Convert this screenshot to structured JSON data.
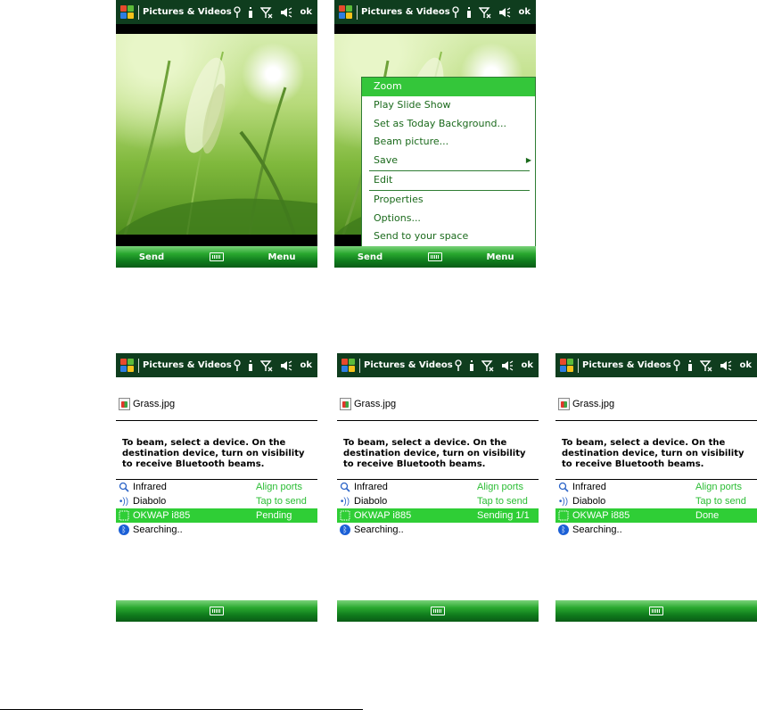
{
  "app": {
    "title": "Pictures & Videos",
    "ok": "ok"
  },
  "top_left": {
    "soft_left": "Send",
    "soft_right": "Menu"
  },
  "top_right": {
    "soft_left": "Send",
    "soft_right": "Menu",
    "menu": [
      {
        "label": "Zoom",
        "selected": true
      },
      {
        "label": "Play Slide Show"
      },
      {
        "label": "Set as Today Background..."
      },
      {
        "label": "Beam picture..."
      },
      {
        "label": "Save",
        "submenu": true
      },
      {
        "label": "Edit"
      },
      {
        "label": "Properties"
      },
      {
        "label": "Options..."
      },
      {
        "label": "Send to your space"
      }
    ]
  },
  "beam": {
    "file_name": "Grass.jpg",
    "instructions": "To beam, select a device. On the destination device, turn on visibility to receive Bluetooth beams.",
    "devices": [
      {
        "name": "Infrared",
        "icon": "infrared-search-icon"
      },
      {
        "name": "Diabolo",
        "icon": "wireless-device-icon"
      },
      {
        "name": "OKWAP i885",
        "icon": "phone-device-icon"
      },
      {
        "name": "Searching..",
        "icon": "bluetooth-icon"
      }
    ],
    "screens": [
      {
        "statuses": [
          "Align ports",
          "Tap to send",
          "Pending",
          ""
        ]
      },
      {
        "statuses": [
          "Align ports",
          "Tap to send",
          "Sending 1/1",
          ""
        ]
      },
      {
        "statuses": [
          "Align ports",
          "Tap to send",
          "Done",
          ""
        ]
      }
    ]
  },
  "colors": {
    "titlebar": "#0f3d1e",
    "highlight": "#2fce36",
    "status_text": "#2bbd34",
    "menu_text": "#1b6a1c"
  }
}
